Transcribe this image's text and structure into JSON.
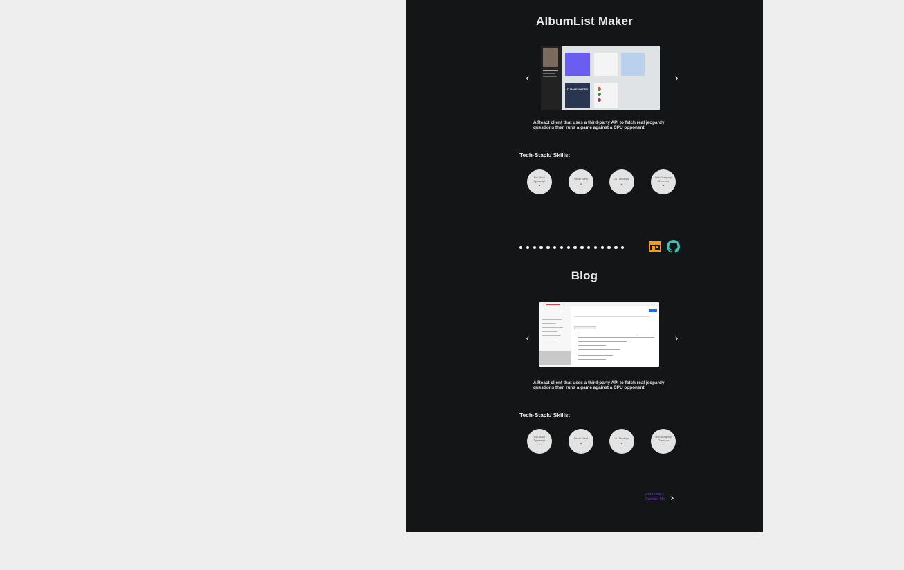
{
  "colors": {
    "page_bg": "#eeeeee",
    "frame_bg": "#141517",
    "accent_purple": "#6b35d6",
    "icon_orange": "#f59b1c",
    "icon_teal": "#3fc1b9"
  },
  "projects": [
    {
      "title": "AlbumList Maker",
      "description": "A React client that uses a third-party API to  fetch real jeopardy questions then runs a game against a CPU opponent.",
      "tech_label": "Tech-Stack/ Skills:",
      "skills": [
        "Full-Stack Typescript",
        "React Client",
        "UI / Mockups",
        "Web-Scraping/ Cheerio.js"
      ],
      "screenshot_text": "PHRASE HUNTER"
    },
    {
      "title": "Blog",
      "description": "A React client that uses a third-party API to  fetch real jeopardy questions then runs a game against a CPU opponent.",
      "tech_label": "Tech-Stack/ Skills:",
      "skills": [
        "Full-Stack Typescript",
        "React Client",
        "UI / Mockups",
        "Web-Scraping/ Cheerio.js"
      ]
    }
  ],
  "pagination": {
    "dot_count": 16
  },
  "icons": {
    "website": "browser-window-icon",
    "github": "github-icon",
    "prev": "chevron-left-icon",
    "next": "chevron-right-icon",
    "expand": "chevron-down-icon"
  },
  "footer": {
    "contact_line1": "About Me /",
    "contact_line2": "Contact Me"
  }
}
